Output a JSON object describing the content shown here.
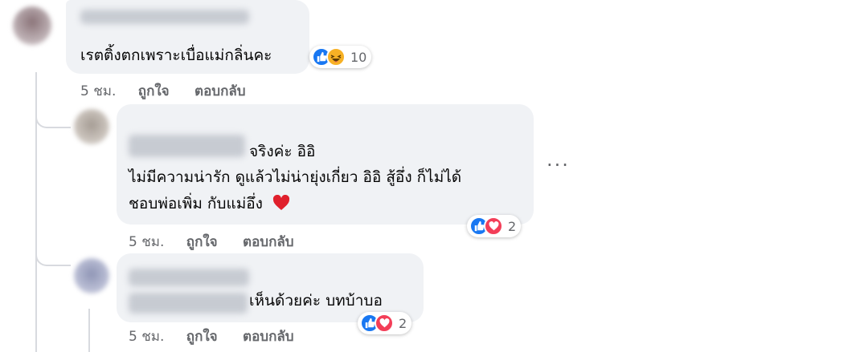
{
  "comments": [
    {
      "text_lines": [
        "เรตติ้งตกเพราะเบื่อแม่กลิ่นคะ"
      ],
      "time": "5 ชม.",
      "like_label": "ถูกใจ",
      "reply_label": "ตอบกลับ",
      "reaction_icons": [
        "like-icon",
        "haha-icon"
      ],
      "reaction_count": "10"
    },
    {
      "text_lines": [
        "จริงค่ะ อิอิ",
        "ไม่มีความน่ารัก ดูแล้วไม่น่ายุ่งเกี่ยว อิอิ สู้อึ่ง ก็ไม่ได้",
        "ชอบพ่อเพิ่ม กับแม่อึ่ง"
      ],
      "heart_emoji": "❤️",
      "time": "5 ชม.",
      "like_label": "ถูกใจ",
      "reply_label": "ตอบกลับ",
      "reaction_icons": [
        "like-icon",
        "love-icon"
      ],
      "reaction_count": "2",
      "more_label": "···"
    },
    {
      "text_lines": [
        "เห็นด้วยค่ะ บทบ้าบอ"
      ],
      "time": "5 ชม.",
      "like_label": "ถูกใจ",
      "reply_label": "ตอบกลับ",
      "reaction_icons": [
        "like-icon",
        "love-icon"
      ],
      "reaction_count": "2"
    }
  ],
  "colors": {
    "bubble": "#f0f2f5",
    "meta_text": "#65676b",
    "like": "#1877f2",
    "love": "#f33e58",
    "haha": "#f7b125"
  }
}
